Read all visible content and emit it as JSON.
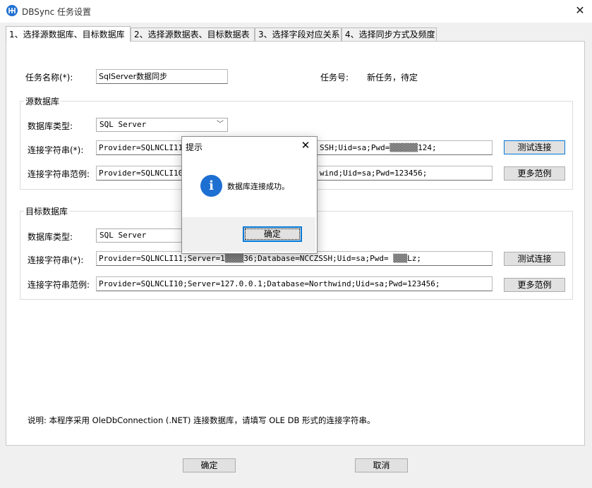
{
  "window": {
    "title": "DBSync 任务设置",
    "close_glyph": "✕"
  },
  "tabs": [
    {
      "label": "1、选择源数据库、目标数据库"
    },
    {
      "label": "2、选择源数据表、目标数据表"
    },
    {
      "label": "3、选择字段对应关系"
    },
    {
      "label": "4、选择同步方式及频度"
    }
  ],
  "task": {
    "name_label": "任务名称(*):",
    "name_value": "SqlServer数据同步",
    "id_label": "任务号:",
    "id_value": "新任务，待定"
  },
  "source": {
    "group_title": "源数据库",
    "type_label": "数据库类型:",
    "type_value": "SQL Server",
    "conn_label": "连接字符串(*):",
    "conn_value_left": "Provider=SQLNCLI11;S",
    "conn_value_right": "SSH;Uid=sa;Pwd=▒▒▒▒▒▒124;",
    "test_button": "测试连接",
    "example_label": "连接字符串范例:",
    "example_value_left": "Provider=SQLNCLI10;S",
    "example_value_right": "wind;Uid=sa;Pwd=123456;",
    "more_button": "更多范例"
  },
  "target": {
    "group_title": "目标数据库",
    "type_label": "数据库类型:",
    "type_value": "SQL Server",
    "conn_label": "连接字符串(*):",
    "conn_value": "Provider=SQLNCLI11;Server=1▒▒▒▒36;Database=NCCZSSH;Uid=sa;Pwd= ▒▒▒Lz;",
    "test_button": "测试连接",
    "example_label": "连接字符串范例:",
    "example_value": "Provider=SQLNCLI10;Server=127.0.0.1;Database=Northwind;Uid=sa;Pwd=123456;",
    "more_button": "更多范例"
  },
  "note": "说明: 本程序采用 OleDbConnection (.NET) 连接数据库，请填写 OLE DB 形式的连接字符串。",
  "footer": {
    "ok_label": "确定",
    "cancel_label": "取消"
  },
  "dialog": {
    "title": "提示",
    "message": "数据库连接成功。",
    "icon_glyph": "i",
    "ok_label": "确定",
    "close_glyph": "✕"
  },
  "colors": {
    "accent": "#0078d7",
    "info_icon": "#1e6fd2"
  }
}
